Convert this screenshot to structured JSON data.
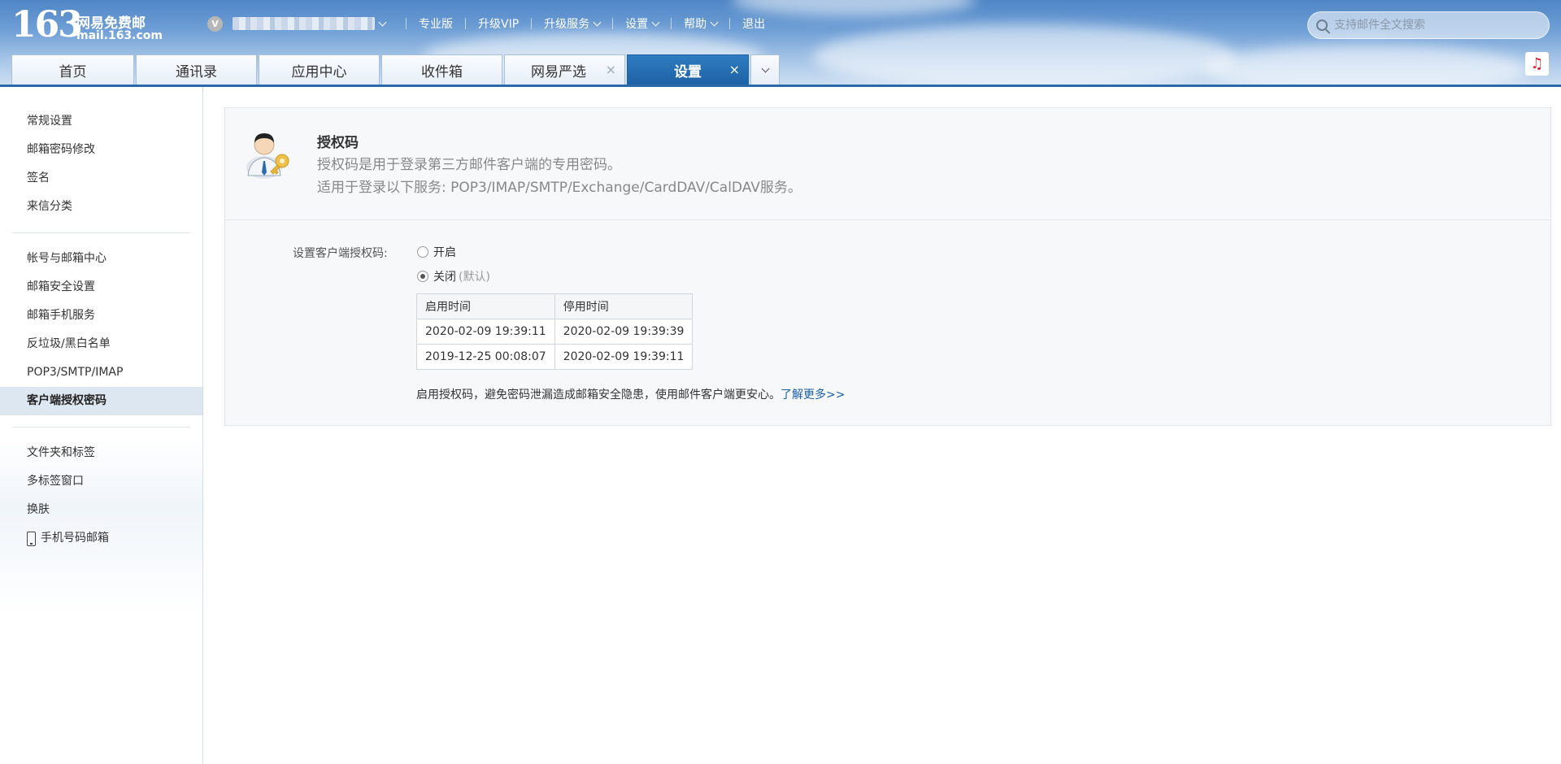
{
  "logo": {
    "number": "163",
    "name_cn": "网易免费邮",
    "domain": "mail.163.com"
  },
  "user": {
    "badge": "V"
  },
  "topnav": {
    "items": [
      {
        "label": "专业版",
        "dropdown": false
      },
      {
        "label": "升级VIP",
        "dropdown": false
      },
      {
        "label": "升级服务",
        "dropdown": true
      },
      {
        "label": "设置",
        "dropdown": true
      },
      {
        "label": "帮助",
        "dropdown": true
      },
      {
        "label": "退出",
        "dropdown": false
      }
    ]
  },
  "search": {
    "placeholder": "支持邮件全文搜索",
    "value": ""
  },
  "music_button": {
    "icon": "music-note-icon",
    "glyph": "♫",
    "color": "#d6232e"
  },
  "tabs": [
    {
      "label": "首页",
      "closable": false,
      "active": false
    },
    {
      "label": "通讯录",
      "closable": false,
      "active": false
    },
    {
      "label": "应用中心",
      "closable": false,
      "active": false
    },
    {
      "label": "收件箱",
      "closable": false,
      "active": false
    },
    {
      "label": "网易严选",
      "closable": true,
      "active": false
    },
    {
      "label": "设置",
      "closable": true,
      "active": true
    }
  ],
  "tab_close_glyph": "×",
  "sidebar": {
    "groups": [
      [
        "常规设置",
        "邮箱密码修改",
        "签名",
        "来信分类"
      ],
      [
        "帐号与邮箱中心",
        "邮箱安全设置",
        "邮箱手机服务",
        "反垃圾/黑白名单",
        "POP3/SMTP/IMAP",
        "客户端授权密码"
      ],
      [
        "文件夹和标签",
        "多标签窗口",
        "换肤",
        "手机号码邮箱"
      ]
    ],
    "active": "客户端授权密码"
  },
  "panel": {
    "title": "授权码",
    "desc_line1": "授权码是用于登录第三方邮件客户端的专用密码。",
    "desc_line2": "适用于登录以下服务: POP3/IMAP/SMTP/Exchange/CardDAV/CalDAV服务。",
    "form_label": "设置客户端授权码:",
    "option_on": "开启",
    "option_off": "关闭",
    "option_off_note": "(默认)",
    "selected": "off",
    "table": {
      "headers": [
        "启用时间",
        "停用时间"
      ],
      "rows": [
        [
          "2020-02-09 19:39:11",
          "2020-02-09 19:39:39"
        ],
        [
          "2019-12-25 00:08:07",
          "2020-02-09 19:39:11"
        ]
      ]
    },
    "tip_text": "启用授权码，避免密码泄漏造成邮箱安全隐患，使用邮件客户端更安心。",
    "tip_link": "了解更多>>"
  },
  "colors": {
    "accent": "#1d62a5",
    "link": "#1b5ea8",
    "header_top": "#4f86c6"
  }
}
